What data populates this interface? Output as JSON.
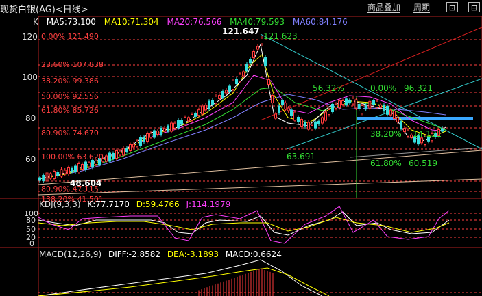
{
  "header": {
    "title": "现货白银(AG)<日线>",
    "product_overlay": "商品叠加",
    "period": "周期",
    "window_buttons": [
      "⊡",
      "⊞"
    ]
  },
  "main_legend": {
    "k": "K",
    "ma5": "MA5:73.100",
    "ma10": "MA10:71.304",
    "ma20": "MA20:76.566",
    "ma40": "MA40:79.593",
    "ma60": "MA60:84.176"
  },
  "y_ticks": [
    "120",
    "100",
    "80",
    "60"
  ],
  "fib_left": [
    "0.00% 121.490",
    "23.60% 107.838",
    "38.20% 99.386",
    "50.00% 92.556",
    "61.80% 85.726",
    "80.90% 74.670",
    "100.00% 63.620",
    "80.90% 47.115",
    "138.20% 41.501"
  ],
  "price_labels": {
    "high": "121.647",
    "high2": "121.623",
    "low_left": "48.604",
    "low_mid": "63.691",
    "low_right": "60.519"
  },
  "fib_right": [
    "56.32%",
    "0.00%",
    "96.321",
    "38.20%",
    "61.80%",
    "14.131"
  ],
  "kdj": {
    "label": "KDJ(9,3,3)",
    "k": "K:77.7170",
    "d": "D:59.4766",
    "j": "J:114.1979",
    "ticks": [
      "100",
      "80",
      "50",
      "20",
      "0"
    ]
  },
  "macd": {
    "label": "MACD(12,26,9)",
    "diff": "DIFF:-2.8582",
    "dea": "DEA:-3.1893",
    "macd": "MACD:0.6624"
  },
  "colors": {
    "up": "#ff3b3b",
    "down": "#34e0e0",
    "ma5": "#ffffff",
    "ma10": "#ffff00",
    "ma20": "#ff40ff",
    "ma40": "#33dd33",
    "ma60": "#8080ff",
    "fib": "#ff4040",
    "green_text": "#33dd33"
  }
}
